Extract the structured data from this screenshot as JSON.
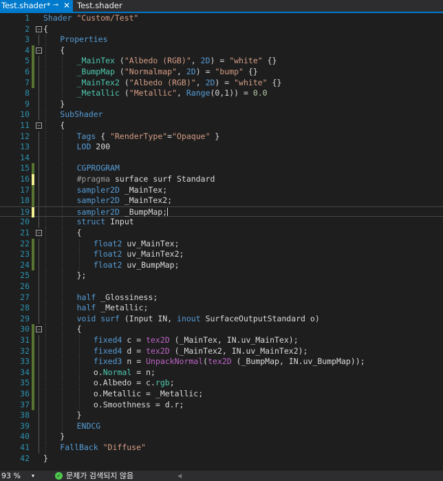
{
  "tabs": {
    "active_label": "Test.shader*",
    "pin_glyph": "⊸",
    "close_glyph": "✕",
    "inactive_label": "Test.shader"
  },
  "editor": {
    "lines": [
      {
        "n": "1",
        "indent": 0,
        "marker": "none",
        "fold": "",
        "tokens": [
          [
            "kw",
            "Shader "
          ],
          [
            "str",
            "\"Custom/Test\""
          ]
        ]
      },
      {
        "n": "2",
        "indent": 0,
        "marker": "none",
        "fold": "−",
        "tokens": [
          [
            "pl",
            "{"
          ]
        ]
      },
      {
        "n": "3",
        "indent": 1,
        "marker": "none",
        "fold": "",
        "tokens": [
          [
            "kw",
            "Properties"
          ]
        ]
      },
      {
        "n": "4",
        "indent": 1,
        "marker": "saved",
        "fold": "−",
        "tokens": [
          [
            "pl",
            "{"
          ]
        ]
      },
      {
        "n": "5",
        "indent": 2,
        "marker": "saved",
        "fold": "",
        "tokens": [
          [
            "pr",
            "_MainTex"
          ],
          [
            "pl",
            " ("
          ],
          [
            "str",
            "\"Albedo (RGB)\""
          ],
          [
            "pl",
            ", "
          ],
          [
            "kw",
            "2D"
          ],
          [
            "pl",
            ") = "
          ],
          [
            "str",
            "\"white\""
          ],
          [
            "pl",
            " {}"
          ]
        ]
      },
      {
        "n": "6",
        "indent": 2,
        "marker": "saved",
        "fold": "",
        "tokens": [
          [
            "pr",
            "_BumpMap"
          ],
          [
            "pl",
            " ("
          ],
          [
            "str",
            "\"Normalmap\""
          ],
          [
            "pl",
            ", "
          ],
          [
            "kw",
            "2D"
          ],
          [
            "pl",
            ") = "
          ],
          [
            "str",
            "\"bump\""
          ],
          [
            "pl",
            " {}"
          ]
        ]
      },
      {
        "n": "7",
        "indent": 2,
        "marker": "saved",
        "fold": "",
        "tokens": [
          [
            "pr",
            "_MainTex2"
          ],
          [
            "pl",
            " ("
          ],
          [
            "str",
            "\"Albedo (RGB)\""
          ],
          [
            "pl",
            ", "
          ],
          [
            "kw",
            "2D"
          ],
          [
            "pl",
            ") = "
          ],
          [
            "str",
            "\"white\""
          ],
          [
            "pl",
            " {}"
          ]
        ]
      },
      {
        "n": "8",
        "indent": 2,
        "marker": "none",
        "fold": "",
        "tokens": [
          [
            "pr",
            "_Metallic"
          ],
          [
            "pl",
            " ("
          ],
          [
            "str",
            "\"Metallic\""
          ],
          [
            "pl",
            ", "
          ],
          [
            "kw",
            "Range"
          ],
          [
            "pl",
            "(0,1)) = "
          ],
          [
            "num",
            "0.0"
          ]
        ]
      },
      {
        "n": "9",
        "indent": 1,
        "marker": "none",
        "fold": "",
        "tokens": [
          [
            "pl",
            "}"
          ]
        ]
      },
      {
        "n": "10",
        "indent": 1,
        "marker": "none",
        "fold": "",
        "tokens": [
          [
            "kw",
            "SubShader"
          ]
        ]
      },
      {
        "n": "11",
        "indent": 1,
        "marker": "none",
        "fold": "−",
        "tokens": [
          [
            "pl",
            "{"
          ]
        ]
      },
      {
        "n": "12",
        "indent": 2,
        "marker": "none",
        "fold": "",
        "tokens": [
          [
            "kw",
            "Tags"
          ],
          [
            "pl",
            " { "
          ],
          [
            "str",
            "\"RenderType\""
          ],
          [
            "pl",
            "="
          ],
          [
            "str",
            "\"Opaque\""
          ],
          [
            "pl",
            " }"
          ]
        ]
      },
      {
        "n": "13",
        "indent": 2,
        "marker": "none",
        "fold": "",
        "tokens": [
          [
            "kw",
            "LOD"
          ],
          [
            "pl",
            " 200"
          ]
        ]
      },
      {
        "n": "14",
        "indent": 2,
        "marker": "none",
        "fold": "",
        "tokens": []
      },
      {
        "n": "15",
        "indent": 2,
        "marker": "saved",
        "fold": "",
        "tokens": [
          [
            "kw",
            "CGPROGRAM"
          ]
        ]
      },
      {
        "n": "16",
        "indent": 2,
        "marker": "unsaved",
        "fold": "",
        "tokens": [
          [
            "dir",
            "#pragma"
          ],
          [
            "pl",
            " surface surf Standard"
          ]
        ]
      },
      {
        "n": "17",
        "indent": 2,
        "marker": "saved",
        "fold": "",
        "tokens": [
          [
            "kw",
            "sampler2D"
          ],
          [
            "pl",
            " _MainTex;"
          ]
        ]
      },
      {
        "n": "18",
        "indent": 2,
        "marker": "saved",
        "fold": "",
        "tokens": [
          [
            "kw",
            "sampler2D"
          ],
          [
            "pl",
            " _MainTex2;"
          ]
        ]
      },
      {
        "n": "19",
        "indent": 2,
        "marker": "unsaved",
        "fold": "",
        "current": true,
        "tokens": [
          [
            "kw",
            "sampler2D"
          ],
          [
            "pl",
            " _BumpMap;"
          ],
          [
            "caret",
            ""
          ]
        ]
      },
      {
        "n": "20",
        "indent": 2,
        "marker": "none",
        "fold": "",
        "tokens": [
          [
            "kw",
            "struct"
          ],
          [
            "pl",
            " Input"
          ]
        ]
      },
      {
        "n": "21",
        "indent": 2,
        "marker": "none",
        "fold": "−",
        "tokens": [
          [
            "pl",
            "{"
          ]
        ]
      },
      {
        "n": "22",
        "indent": 3,
        "marker": "saved",
        "fold": "",
        "tokens": [
          [
            "kw",
            "float2"
          ],
          [
            "pl",
            " uv_MainTex;"
          ]
        ]
      },
      {
        "n": "23",
        "indent": 3,
        "marker": "saved",
        "fold": "",
        "tokens": [
          [
            "kw",
            "float2"
          ],
          [
            "pl",
            " uv_MainTex2;"
          ]
        ]
      },
      {
        "n": "24",
        "indent": 3,
        "marker": "saved",
        "fold": "",
        "tokens": [
          [
            "kw",
            "float2"
          ],
          [
            "pl",
            " uv_BumpMap;"
          ]
        ]
      },
      {
        "n": "25",
        "indent": 2,
        "marker": "none",
        "fold": "",
        "tokens": [
          [
            "pl",
            "};"
          ]
        ]
      },
      {
        "n": "26",
        "indent": 2,
        "marker": "none",
        "fold": "",
        "tokens": []
      },
      {
        "n": "27",
        "indent": 2,
        "marker": "none",
        "fold": "",
        "tokens": [
          [
            "kw",
            "half"
          ],
          [
            "pl",
            " _Glossiness;"
          ]
        ]
      },
      {
        "n": "28",
        "indent": 2,
        "marker": "none",
        "fold": "",
        "tokens": [
          [
            "kw",
            "half"
          ],
          [
            "pl",
            " _Metallic;"
          ]
        ]
      },
      {
        "n": "29",
        "indent": 2,
        "marker": "none",
        "fold": "",
        "tokens": [
          [
            "kw",
            "void"
          ],
          [
            "pl",
            " "
          ],
          [
            "kw",
            "surf"
          ],
          [
            "pl",
            " (Input IN, "
          ],
          [
            "kw",
            "inout"
          ],
          [
            "pl",
            " SurfaceOutputStandard o)"
          ]
        ]
      },
      {
        "n": "30",
        "indent": 2,
        "marker": "saved",
        "fold": "−",
        "tokens": [
          [
            "pl",
            "{"
          ]
        ]
      },
      {
        "n": "31",
        "indent": 3,
        "marker": "saved",
        "fold": "",
        "tokens": [
          [
            "kw",
            "fixed4"
          ],
          [
            "pl",
            " c = "
          ],
          [
            "mac",
            "tex2D"
          ],
          [
            "pl",
            " (_MainTex, IN.uv_MainTex);"
          ]
        ]
      },
      {
        "n": "32",
        "indent": 3,
        "marker": "saved",
        "fold": "",
        "tokens": [
          [
            "kw",
            "fixed4"
          ],
          [
            "pl",
            " d = "
          ],
          [
            "mac",
            "tex2D"
          ],
          [
            "pl",
            " (_MainTex2, IN.uv_MainTex2);"
          ]
        ]
      },
      {
        "n": "33",
        "indent": 3,
        "marker": "saved",
        "fold": "",
        "tokens": [
          [
            "kw",
            "fixed3"
          ],
          [
            "pl",
            " n = "
          ],
          [
            "mac",
            "UnpackNormal"
          ],
          [
            "pl",
            "("
          ],
          [
            "mac",
            "tex2D"
          ],
          [
            "pl",
            " (_BumpMap, IN.uv_BumpMap));"
          ]
        ]
      },
      {
        "n": "34",
        "indent": 3,
        "marker": "saved",
        "fold": "",
        "tokens": [
          [
            "pl",
            "o."
          ],
          [
            "ty",
            "Normal"
          ],
          [
            "pl",
            " = n;"
          ]
        ]
      },
      {
        "n": "35",
        "indent": 3,
        "marker": "saved",
        "fold": "",
        "tokens": [
          [
            "pl",
            "o.Albedo = c."
          ],
          [
            "ty",
            "rgb"
          ],
          [
            "pl",
            ";"
          ]
        ]
      },
      {
        "n": "36",
        "indent": 3,
        "marker": "saved",
        "fold": "",
        "tokens": [
          [
            "pl",
            "o.Metallic = _Metallic;"
          ]
        ]
      },
      {
        "n": "37",
        "indent": 3,
        "marker": "saved",
        "fold": "",
        "tokens": [
          [
            "pl",
            "o.Smoothness = d.r;"
          ]
        ]
      },
      {
        "n": "38",
        "indent": 2,
        "marker": "none",
        "fold": "",
        "tokens": [
          [
            "pl",
            "}"
          ]
        ]
      },
      {
        "n": "39",
        "indent": 2,
        "marker": "none",
        "fold": "",
        "tokens": [
          [
            "kw",
            "ENDCG"
          ]
        ]
      },
      {
        "n": "40",
        "indent": 1,
        "marker": "none",
        "fold": "",
        "tokens": [
          [
            "pl",
            "}"
          ]
        ]
      },
      {
        "n": "41",
        "indent": 1,
        "marker": "none",
        "fold": "",
        "tokens": [
          [
            "kw",
            "FallBack"
          ],
          [
            "pl",
            " "
          ],
          [
            "str",
            "\"Diffuse\""
          ]
        ]
      },
      {
        "n": "42",
        "indent": 0,
        "marker": "none",
        "fold": "",
        "tokens": [
          [
            "pl",
            "}"
          ]
        ]
      }
    ]
  },
  "status": {
    "zoom": "93 %",
    "zoom_arrow": "▾",
    "issues_glyph": "✓",
    "issues_text": "문제가 검색되지 않음",
    "scroll_left": "◀"
  },
  "colors": {
    "accent": "#007acc",
    "background": "#1e1e1e",
    "line_number": "#2b91af",
    "keyword": "#569cd6",
    "string": "#d69d85",
    "saved_change": "#577430",
    "unsaved_change": "#efef91"
  }
}
